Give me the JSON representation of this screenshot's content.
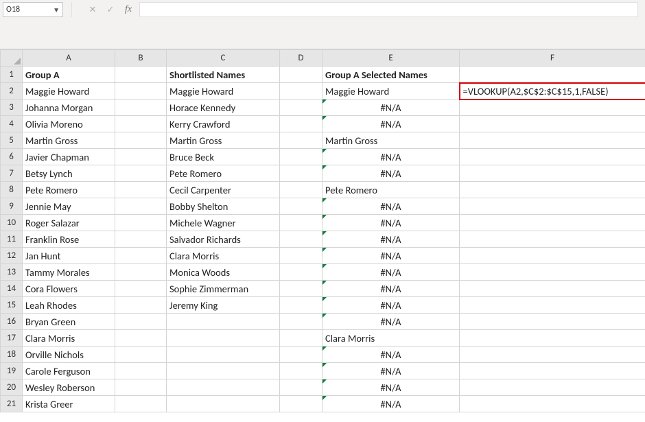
{
  "namebox": {
    "cell_ref": "O18"
  },
  "formula_bar": {
    "value": ""
  },
  "columns": [
    "A",
    "B",
    "C",
    "D",
    "E",
    "F"
  ],
  "rows": [
    "1",
    "2",
    "3",
    "4",
    "5",
    "6",
    "7",
    "8",
    "9",
    "10",
    "11",
    "12",
    "13",
    "14",
    "15",
    "16",
    "17",
    "18",
    "19",
    "20",
    "21"
  ],
  "headers": {
    "A": "Group A",
    "C": "Shortlisted Names",
    "E": "Group A Selected Names"
  },
  "colA": [
    "Maggie Howard",
    "Johanna Morgan",
    "Olivia Moreno",
    "Martin Gross",
    "Javier Chapman",
    "Betsy Lynch",
    "Pete Romero",
    "Jennie May",
    "Roger Salazar",
    "Franklin Rose",
    "Jan Hunt",
    "Tammy Morales",
    "Cora Flowers",
    "Leah Rhodes",
    "Bryan Green",
    "Clara Morris",
    "Orville Nichols",
    "Carole Ferguson",
    "Wesley Roberson",
    "Krista Greer"
  ],
  "colC": [
    "Maggie Howard",
    "Horace Kennedy",
    "Kerry Crawford",
    "Martin Gross",
    "Bruce Beck",
    "Pete Romero",
    "Cecil Carpenter",
    "Bobby Shelton",
    "Michele Wagner",
    "Salvador Richards",
    "Clara Morris",
    "Monica Woods",
    "Sophie Zimmerman",
    "Jeremy King"
  ],
  "colE": [
    "Maggie Howard",
    "#N/A",
    "#N/A",
    "Martin Gross",
    "#N/A",
    "#N/A",
    "Pete Romero",
    "#N/A",
    "#N/A",
    "#N/A",
    "#N/A",
    "#N/A",
    "#N/A",
    "#N/A",
    "#N/A",
    "Clara Morris",
    "#N/A",
    "#N/A",
    "#N/A",
    "#N/A"
  ],
  "colE_err": [
    false,
    true,
    true,
    false,
    true,
    true,
    false,
    true,
    true,
    true,
    true,
    true,
    true,
    true,
    true,
    false,
    true,
    true,
    true,
    true
  ],
  "F2": "=VLOOKUP(A2,$C$2:$C$15,1,FALSE)"
}
